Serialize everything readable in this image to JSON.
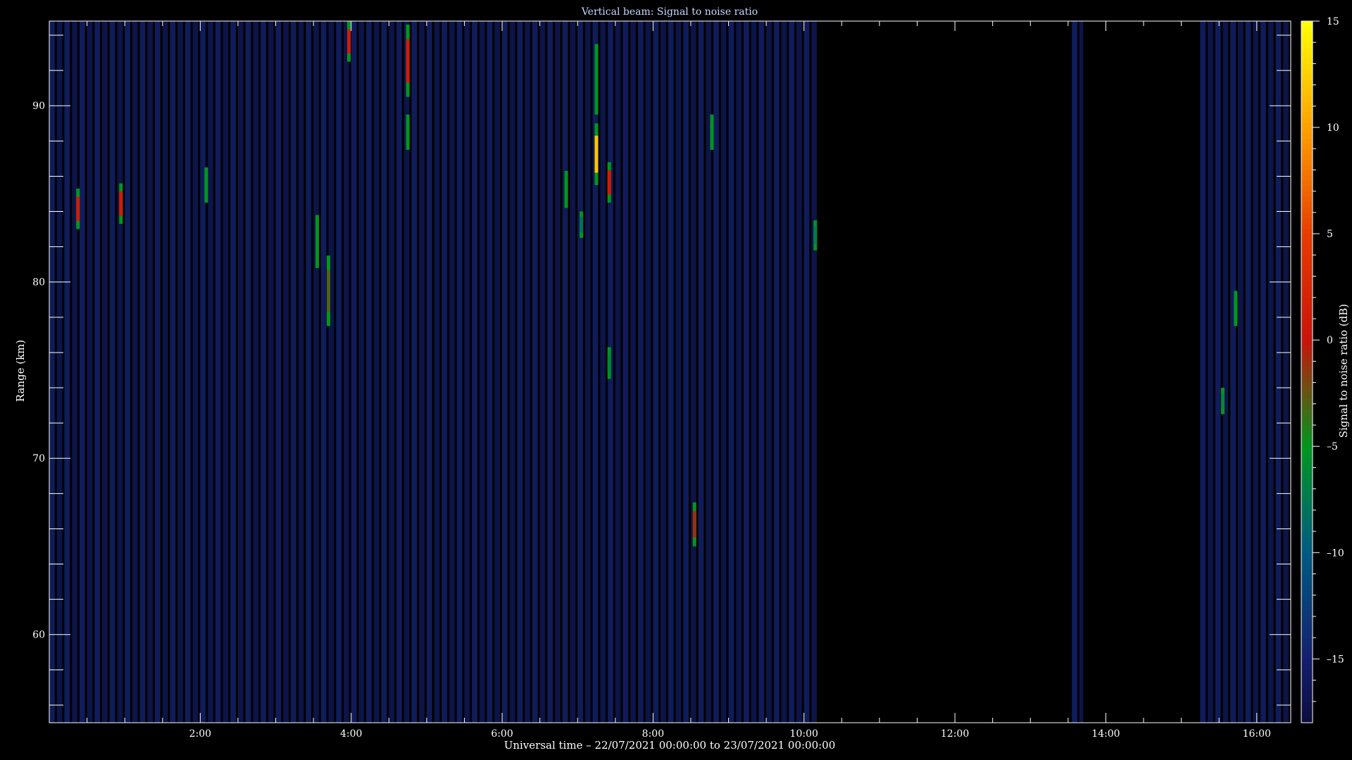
{
  "chart_data": {
    "type": "heatmap",
    "title": "Vertical beam: Signal to noise ratio",
    "xlabel": "Universal time – 22/07/2021 00:00:00 to 23/07/2021 00:00:00",
    "ylabel": "Range (km)",
    "colorbar_label": "Signal to noise ratio (dB)",
    "xlim": [
      0.0,
      16.45
    ],
    "ylim": [
      55.0,
      94.8
    ],
    "clim": [
      -18.0,
      15.0
    ],
    "x_ticks": [
      {
        "value": 2,
        "label": "2:00"
      },
      {
        "value": 4,
        "label": "4:00"
      },
      {
        "value": 6,
        "label": "6:00"
      },
      {
        "value": 8,
        "label": "8:00"
      },
      {
        "value": 10,
        "label": "10:00"
      },
      {
        "value": 12,
        "label": "12:00"
      },
      {
        "value": 14,
        "label": "14:00"
      },
      {
        "value": 16,
        "label": "16:00"
      }
    ],
    "y_ticks": [
      {
        "value": 60,
        "label": "60"
      },
      {
        "value": 70,
        "label": "70"
      },
      {
        "value": 80,
        "label": "80"
      },
      {
        "value": 90,
        "label": "90"
      }
    ],
    "colorbar_ticks": [
      {
        "value": -15,
        "label": "–15"
      },
      {
        "value": -10,
        "label": "–10"
      },
      {
        "value": -5,
        "label": "–5"
      },
      {
        "value": 0,
        "label": "0"
      },
      {
        "value": 5,
        "label": "5"
      },
      {
        "value": 10,
        "label": "10"
      },
      {
        "value": 15,
        "label": "15"
      }
    ],
    "background_snr_db": -16,
    "data_intervals_hours": [
      [
        0.0,
        10.2
      ],
      [
        13.55,
        13.72
      ],
      [
        15.25,
        16.45
      ]
    ],
    "echoes": [
      {
        "time": 0.38,
        "range_top": 85.3,
        "range_bottom": 83.0,
        "peak_snr": 1
      },
      {
        "time": 0.95,
        "range_top": 85.6,
        "range_bottom": 83.3,
        "peak_snr": 1
      },
      {
        "time": 2.08,
        "range_top": 86.5,
        "range_bottom": 84.5,
        "peak_snr": -5
      },
      {
        "time": 3.55,
        "range_top": 83.8,
        "range_bottom": 80.8,
        "peak_snr": -5
      },
      {
        "time": 3.7,
        "range_top": 81.5,
        "range_bottom": 77.5,
        "peak_snr": -3
      },
      {
        "time": 3.97,
        "range_top": 94.8,
        "range_bottom": 92.5,
        "peak_snr": 1
      },
      {
        "time": 4.75,
        "range_top": 94.6,
        "range_bottom": 90.5,
        "peak_snr": 1
      },
      {
        "time": 4.75,
        "range_top": 89.5,
        "range_bottom": 87.5,
        "peak_snr": -5
      },
      {
        "time": 6.85,
        "range_top": 86.3,
        "range_bottom": 84.2,
        "peak_snr": -5
      },
      {
        "time": 7.05,
        "range_top": 84.0,
        "range_bottom": 82.5,
        "peak_snr": -8
      },
      {
        "time": 7.25,
        "range_top": 93.5,
        "range_bottom": 89.5,
        "peak_snr": -5
      },
      {
        "time": 7.25,
        "range_top": 89.0,
        "range_bottom": 85.5,
        "peak_snr": 12
      },
      {
        "time": 7.42,
        "range_top": 86.8,
        "range_bottom": 84.5,
        "peak_snr": 1
      },
      {
        "time": 7.42,
        "range_top": 76.3,
        "range_bottom": 74.5,
        "peak_snr": -6
      },
      {
        "time": 8.55,
        "range_top": 67.5,
        "range_bottom": 65.0,
        "peak_snr": -1
      },
      {
        "time": 8.78,
        "range_top": 89.5,
        "range_bottom": 87.5,
        "peak_snr": -5
      },
      {
        "time": 10.15,
        "range_top": 83.5,
        "range_bottom": 81.8,
        "peak_snr": -7
      },
      {
        "time": 15.55,
        "range_top": 74.0,
        "range_bottom": 72.5,
        "peak_snr": -6
      },
      {
        "time": 15.72,
        "range_top": 79.5,
        "range_bottom": 77.5,
        "peak_snr": -5
      }
    ]
  }
}
